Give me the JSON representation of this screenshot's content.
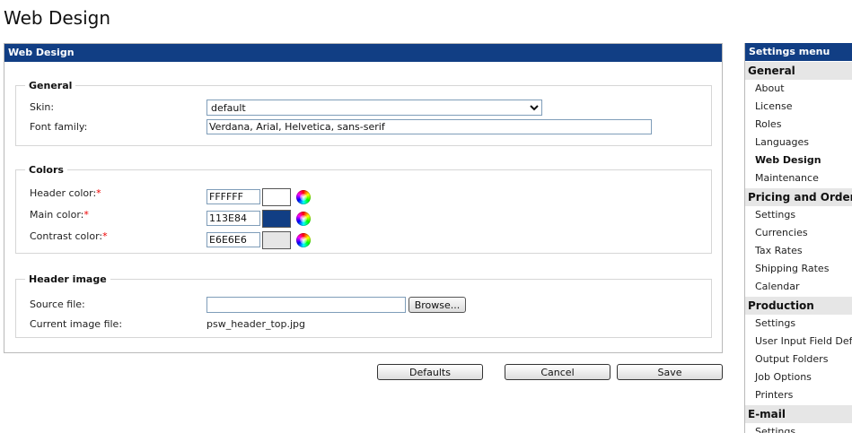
{
  "page": {
    "title": "Web Design"
  },
  "panel": {
    "title": "Web Design",
    "general": {
      "legend": "General",
      "skin_label": "Skin:",
      "skin_value": "default",
      "font_label": "Font family:",
      "font_value": "Verdana, Arial, Helvetica, sans-serif"
    },
    "colors": {
      "legend": "Colors",
      "required_mark": "*",
      "items": [
        {
          "label": "Header color:",
          "value": "FFFFFF",
          "swatch": "#FFFFFF"
        },
        {
          "label": "Main color:",
          "value": "113E84",
          "swatch": "#113E84"
        },
        {
          "label": "Contrast color:",
          "value": "E6E6E6",
          "swatch": "#E6E6E6"
        }
      ]
    },
    "header_image": {
      "legend": "Header image",
      "source_label": "Source file:",
      "source_value": "",
      "browse_label": "Browse...",
      "current_label": "Current image file:",
      "current_value": "psw_header_top.jpg"
    }
  },
  "actions": {
    "defaults": "Defaults",
    "cancel": "Cancel",
    "save": "Save"
  },
  "menu": {
    "title": "Settings menu",
    "sections": [
      {
        "title": "General",
        "items": [
          "About",
          "License",
          "Roles",
          "Languages",
          "Web Design",
          "Maintenance"
        ]
      },
      {
        "title": "Pricing and Ordering",
        "items": [
          "Settings",
          "Currencies",
          "Tax Rates",
          "Shipping Rates",
          "Calendar"
        ]
      },
      {
        "title": "Production",
        "items": [
          "Settings",
          "User Input Field Definitions",
          "Output Folders",
          "Job Options",
          "Printers"
        ]
      },
      {
        "title": "E-mail",
        "items": [
          "Settings"
        ]
      }
    ],
    "active_item": "Web Design"
  },
  "colors": {
    "brand": "#113E84",
    "contrast": "#E6E6E6",
    "required": "#EE0000"
  }
}
